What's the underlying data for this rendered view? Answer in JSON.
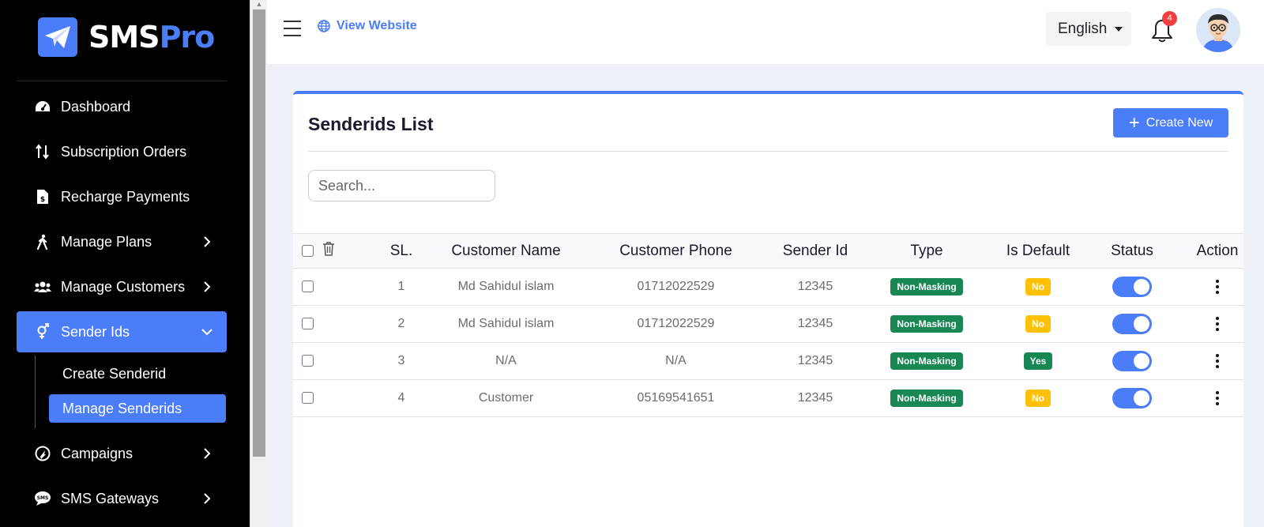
{
  "brand": {
    "name_main": "SMS",
    "name_accent": "Pro",
    "accent_color": "#4a7df7"
  },
  "sidebar": {
    "items": [
      {
        "label": "Dashboard",
        "icon": "speedometer-icon",
        "chevron": false
      },
      {
        "label": "Subscription Orders",
        "icon": "sort-arrows-icon",
        "chevron": false
      },
      {
        "label": "Recharge Payments",
        "icon": "invoice-dollar-icon",
        "chevron": false
      },
      {
        "label": "Manage Plans",
        "icon": "walking-person-icon",
        "chevron": true
      },
      {
        "label": "Manage Customers",
        "icon": "users-icon",
        "chevron": true
      },
      {
        "label": "Sender Ids",
        "icon": "gender-icon",
        "chevron": true,
        "active": true
      },
      {
        "label": "Campaigns",
        "icon": "campaign-icon",
        "chevron": true
      },
      {
        "label": "SMS Gateways",
        "icon": "sms-bubble-icon",
        "chevron": true
      }
    ],
    "sub_items": [
      {
        "label": "Create Senderid",
        "active": false
      },
      {
        "label": "Manage Senderids",
        "active": true
      }
    ]
  },
  "header": {
    "view_website": "View Website",
    "language": "English",
    "notification_count": "4"
  },
  "card": {
    "title": "Senderids List",
    "create_label": "Create New",
    "search_placeholder": "Search..."
  },
  "table": {
    "headers": [
      "SL.",
      "Customer Name",
      "Customer Phone",
      "Sender Id",
      "Type",
      "Is Default",
      "Status",
      "Action"
    ],
    "rows": [
      {
        "sl": "1",
        "name": "Md Sahidul islam",
        "phone": "01712022529",
        "sender_id": "12345",
        "type": "Non-Masking",
        "is_default": "No",
        "status": true
      },
      {
        "sl": "2",
        "name": "Md Sahidul islam",
        "phone": "01712022529",
        "sender_id": "12345",
        "type": "Non-Masking",
        "is_default": "No",
        "status": true
      },
      {
        "sl": "3",
        "name": "N/A",
        "phone": "N/A",
        "sender_id": "12345",
        "type": "Non-Masking",
        "is_default": "Yes",
        "status": true
      },
      {
        "sl": "4",
        "name": "Customer",
        "phone": "05169541651",
        "sender_id": "12345",
        "type": "Non-Masking",
        "is_default": "No",
        "status": true
      }
    ]
  }
}
